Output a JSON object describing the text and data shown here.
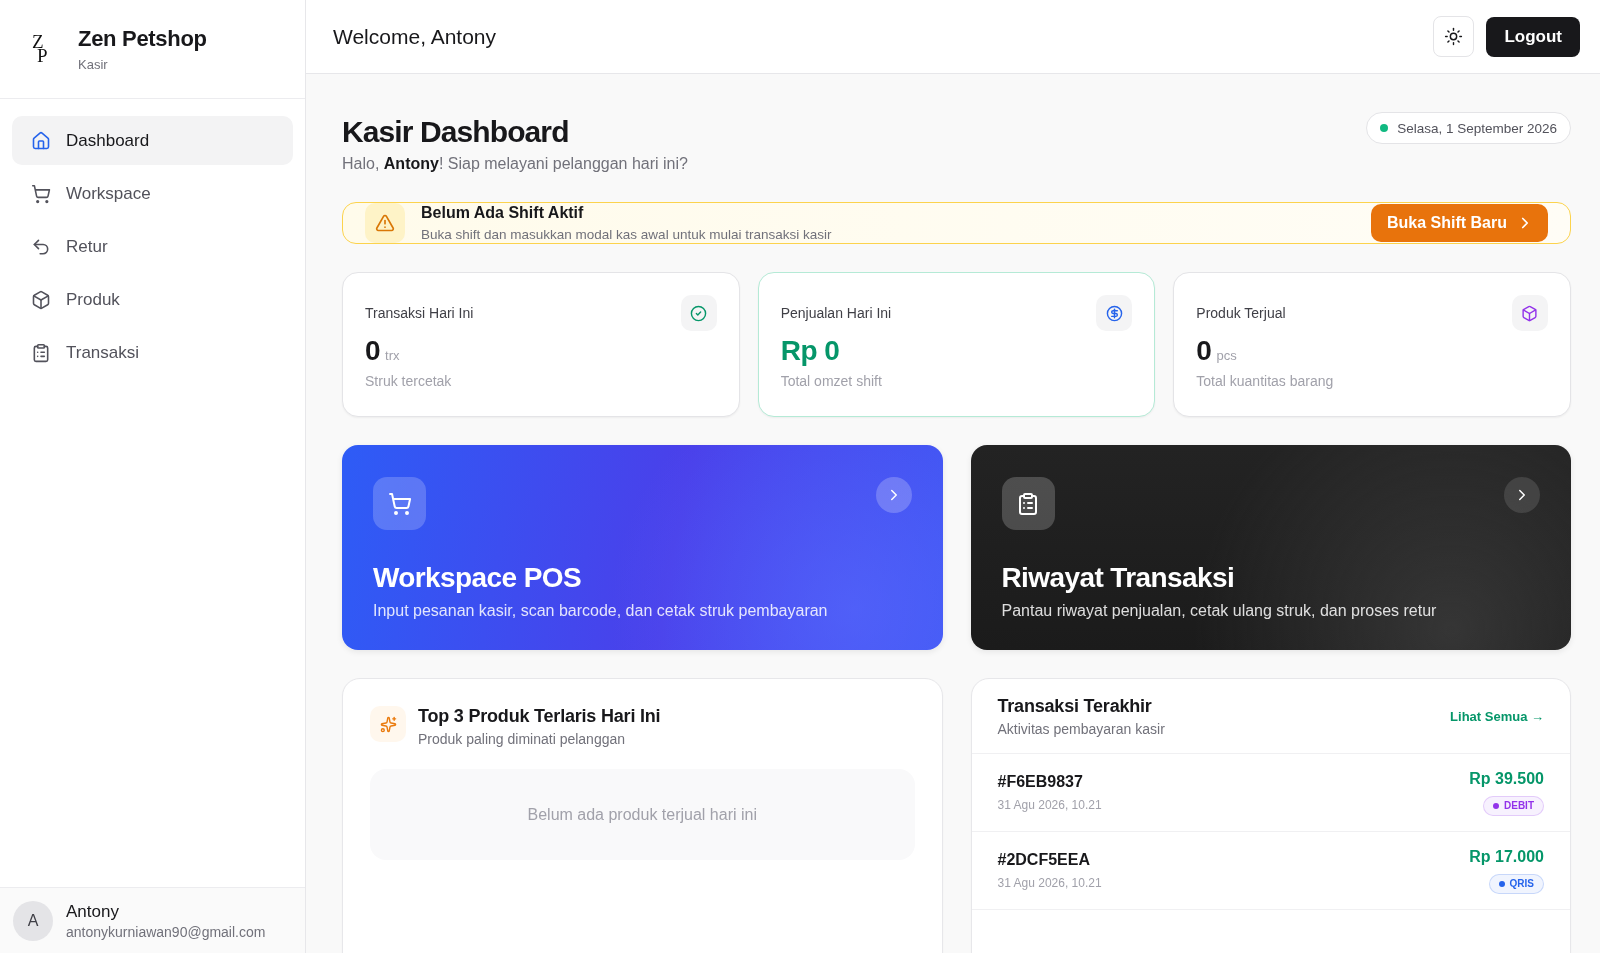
{
  "brand": {
    "logo": "ZP",
    "name": "Zen Petshop",
    "role": "Kasir"
  },
  "nav": [
    {
      "label": "Dashboard",
      "selected": true
    },
    {
      "label": "Workspace",
      "selected": false
    },
    {
      "label": "Retur",
      "selected": false
    },
    {
      "label": "Produk",
      "selected": false
    },
    {
      "label": "Transaksi",
      "selected": false
    }
  ],
  "user": {
    "initial": "A",
    "name": "Antony",
    "email": "antonykurniawan90@gmail.com"
  },
  "header": {
    "welcome": "Welcome, Antony",
    "logout": "Logout"
  },
  "page": {
    "title": "Kasir Dashboard",
    "greeting": "Halo, **Antony**! Siap melayani pelanggan hari ini?",
    "date": "Selasa, 1 September 2026"
  },
  "shift_alert": {
    "title": "Belum Ada Shift Aktif",
    "message": "Buka shift dan masukkan modal kas awal untuk mulai transaksi kasir",
    "button": "Buka Shift Baru"
  },
  "stats": [
    {
      "kind": "count",
      "label": "Transaksi Hari Ini",
      "value": "0",
      "unit": "trx",
      "caption": "Struk tercetak"
    },
    {
      "kind": "money",
      "label": "Penjualan Hari Ini",
      "value": "Rp 0",
      "caption": "Total omzet shift"
    },
    {
      "kind": "quantity",
      "label": "Produk Terjual",
      "value": "0",
      "unit": "pcs",
      "caption": "Total kuantitas barang"
    }
  ],
  "shortcuts": [
    {
      "kind": "primary",
      "title": "Workspace POS",
      "description": "Input pesanan kasir, scan barcode, dan cetak struk pembayaran"
    },
    {
      "kind": "dark",
      "title": "Riwayat Transaksi",
      "description": "Pantau riwayat penjualan, cetak ulang struk, dan proses retur"
    }
  ],
  "top_products": {
    "title": "Top 3 Produk Terlaris Hari Ini",
    "subtitle": "Produk paling diminati pelanggan",
    "empty": "Belum ada produk terjual hari ini"
  },
  "recent_transactions": {
    "title": "Transaksi Terakhir",
    "subtitle": "Aktivitas pembayaran kasir",
    "link": "Lihat Semua →",
    "rows": [
      {
        "id": "#F6EB9837",
        "time": "31 Agu 2026, 10.21",
        "amount": "Rp 39.500",
        "method": "DEBIT",
        "color": "#9333ea"
      },
      {
        "id": "#2DCF5EEA",
        "time": "31 Agu 2026, 10.21",
        "amount": "Rp 17.000",
        "method": "QRIS",
        "color": "#2563eb"
      }
    ]
  }
}
